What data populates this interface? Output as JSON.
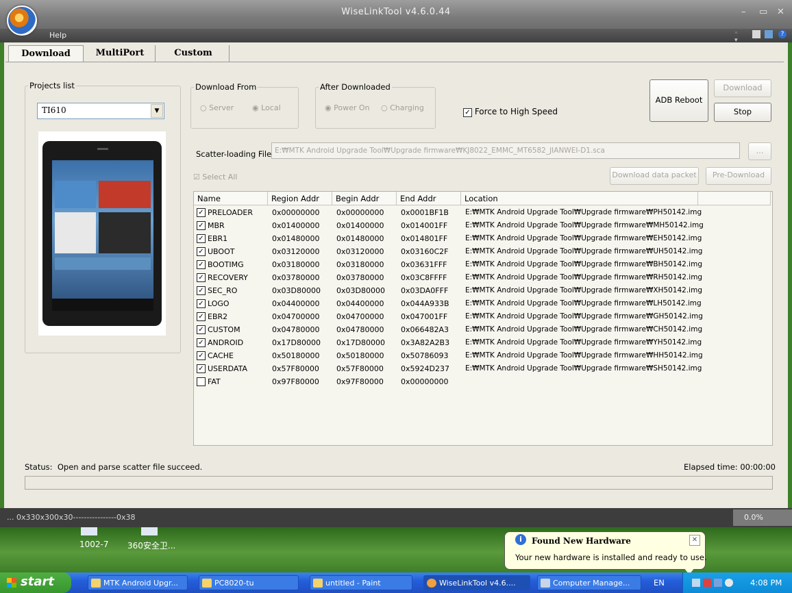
{
  "window": {
    "title": "WiseLinkTool v4.6.0.44",
    "menu_help": "Help"
  },
  "tabs": [
    "Download",
    "MultiPort",
    "Custom"
  ],
  "projects": {
    "legend": "Projects list",
    "selected": "TI610"
  },
  "download_from": {
    "legend": "Download From",
    "server": "Server",
    "local": "Local"
  },
  "after_downloaded": {
    "legend": "After Downloaded",
    "power_on": "Power On",
    "charging": "Charging"
  },
  "force_high_speed": "Force to High Speed",
  "buttons": {
    "adb_reboot": "ADB Reboot",
    "download": "Download",
    "stop": "Stop",
    "browse": "...",
    "download_data_packet": "Download data packet",
    "pre_download": "Pre-Download"
  },
  "scatter": {
    "label": "Scatter-loading File:",
    "value": "E:₩MTK Android Upgrade Tool₩Upgrade firmware₩KJ8022_EMMC_MT6582_JIANWEI-D1.sca"
  },
  "select_all": "Select All",
  "table": {
    "headers": [
      "Name",
      "Region Addr",
      "Begin Addr",
      "End Addr",
      "Location"
    ],
    "rows": [
      {
        "name": "PRELOADER",
        "region": "0x00000000",
        "begin": "0x00000000",
        "end": "0x0001BF1B",
        "location": "E:₩MTK Android Upgrade Tool₩Upgrade firmware₩PH50142.img",
        "checked": true
      },
      {
        "name": "MBR",
        "region": "0x01400000",
        "begin": "0x01400000",
        "end": "0x014001FF",
        "location": "E:₩MTK Android Upgrade Tool₩Upgrade firmware₩MH50142.img",
        "checked": true
      },
      {
        "name": "EBR1",
        "region": "0x01480000",
        "begin": "0x01480000",
        "end": "0x014801FF",
        "location": "E:₩MTK Android Upgrade Tool₩Upgrade firmware₩EH50142.img",
        "checked": true
      },
      {
        "name": "UBOOT",
        "region": "0x03120000",
        "begin": "0x03120000",
        "end": "0x03160C2F",
        "location": "E:₩MTK Android Upgrade Tool₩Upgrade firmware₩UH50142.img",
        "checked": true
      },
      {
        "name": "BOOTIMG",
        "region": "0x03180000",
        "begin": "0x03180000",
        "end": "0x03631FFF",
        "location": "E:₩MTK Android Upgrade Tool₩Upgrade firmware₩BH50142.img",
        "checked": true
      },
      {
        "name": "RECOVERY",
        "region": "0x03780000",
        "begin": "0x03780000",
        "end": "0x03C8FFFF",
        "location": "E:₩MTK Android Upgrade Tool₩Upgrade firmware₩RH50142.img",
        "checked": true
      },
      {
        "name": "SEC_RO",
        "region": "0x03D80000",
        "begin": "0x03D80000",
        "end": "0x03DA0FFF",
        "location": "E:₩MTK Android Upgrade Tool₩Upgrade firmware₩XH50142.img",
        "checked": true
      },
      {
        "name": "LOGO",
        "region": "0x04400000",
        "begin": "0x04400000",
        "end": "0x044A933B",
        "location": "E:₩MTK Android Upgrade Tool₩Upgrade firmware₩LH50142.img",
        "checked": true
      },
      {
        "name": "EBR2",
        "region": "0x04700000",
        "begin": "0x04700000",
        "end": "0x047001FF",
        "location": "E:₩MTK Android Upgrade Tool₩Upgrade firmware₩GH50142.img",
        "checked": true
      },
      {
        "name": "CUSTOM",
        "region": "0x04780000",
        "begin": "0x04780000",
        "end": "0x066482A3",
        "location": "E:₩MTK Android Upgrade Tool₩Upgrade firmware₩CH50142.img",
        "checked": true
      },
      {
        "name": "ANDROID",
        "region": "0x17D80000",
        "begin": "0x17D80000",
        "end": "0x3A82A2B3",
        "location": "E:₩MTK Android Upgrade Tool₩Upgrade firmware₩YH50142.img",
        "checked": true
      },
      {
        "name": "CACHE",
        "region": "0x50180000",
        "begin": "0x50180000",
        "end": "0x50786093",
        "location": "E:₩MTK Android Upgrade Tool₩Upgrade firmware₩HH50142.img",
        "checked": true
      },
      {
        "name": "USERDATA",
        "region": "0x57F80000",
        "begin": "0x57F80000",
        "end": "0x5924D237",
        "location": "E:₩MTK Android Upgrade Tool₩Upgrade firmware₩SH50142.img",
        "checked": true
      },
      {
        "name": "FAT",
        "region": "0x97F80000",
        "begin": "0x97F80000",
        "end": "0x00000000",
        "location": "",
        "checked": false
      }
    ]
  },
  "status": {
    "label": "Status:",
    "text": "Open and parse scatter file succeed.",
    "elapsed": "Elapsed time: 00:00:00"
  },
  "console": {
    "text": "... 0x330x300x30----------------0x38",
    "percent": "0.0%"
  },
  "desktop": {
    "icons": [
      "1002-7",
      "360安全卫..."
    ]
  },
  "balloon": {
    "title": "Found New Hardware",
    "message": "Your new hardware is installed and ready to use."
  },
  "taskbar": {
    "start": "start",
    "items": [
      "MTK Android Upgr...",
      "PC8020-tu",
      "untitled - Paint",
      "WiseLinkTool v4.6....",
      "Computer Manage..."
    ],
    "lang": "EN",
    "clock": "4:08 PM"
  }
}
